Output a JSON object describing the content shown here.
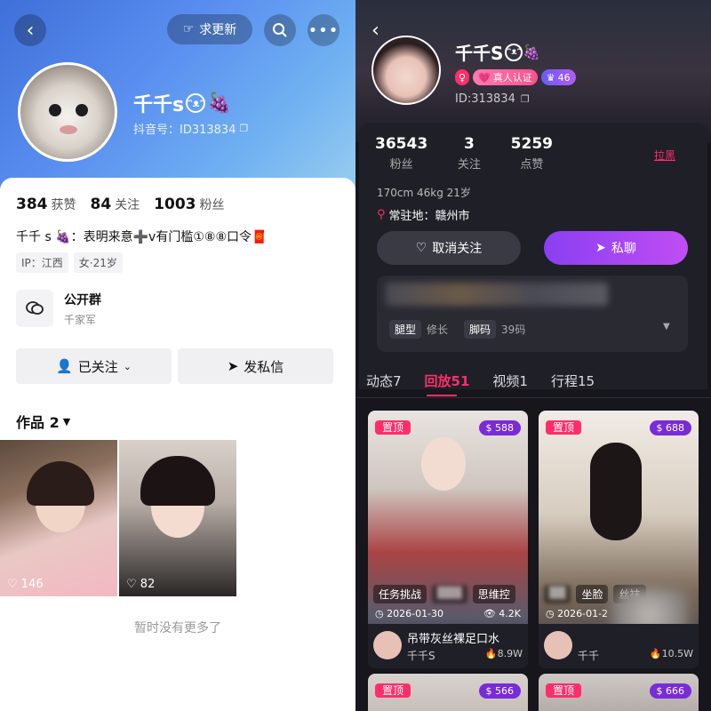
{
  "left": {
    "top_bar": {
      "update_label": "求更新"
    },
    "profile": {
      "name": "千千s",
      "name_emoji": "🍇",
      "douyin_id": "抖音号：ID313834"
    },
    "stats": [
      {
        "num": "384",
        "label": "获赞"
      },
      {
        "num": "84",
        "label": "关注"
      },
      {
        "num": "1003",
        "label": "粉丝"
      }
    ],
    "bio": "千千 s  🍇：表明来意➕v有门槛①⑧⑧口令🧧",
    "tags": [
      "IP：江西",
      "女·21岁"
    ],
    "group": {
      "title": "公开群",
      "subtitle": "千家军"
    },
    "buttons": {
      "followed": "已关注",
      "message": "发私信"
    },
    "works_label": "作品 2",
    "thumbs": [
      {
        "likes": "146"
      },
      {
        "likes": "82"
      }
    ],
    "no_more": "暂时没有更多了"
  },
  "right": {
    "profile": {
      "name": "千千S",
      "id_text": "ID:313834",
      "badge_verified": "真人认证",
      "badge_level": "46"
    },
    "stats": [
      {
        "num": "36543",
        "label": "粉丝"
      },
      {
        "num": "3",
        "label": "关注"
      },
      {
        "num": "5259",
        "label": "点赞"
      }
    ],
    "block_label": "拉黑",
    "body_info": "170cm  46kg  21岁",
    "location": "常驻地：赣州市",
    "buttons": {
      "unfollow": "取消关注",
      "chat": "私聊"
    },
    "attrs": [
      {
        "key": "腿型",
        "val": "修长"
      },
      {
        "key": "脚码",
        "val": "39码"
      }
    ],
    "tabs": [
      "动态7",
      "回放51",
      "视频1",
      "行程15"
    ],
    "cards": [
      {
        "pin": "置顶",
        "coins": "588",
        "chips": [
          "任务挑战",
          "思维控"
        ],
        "date": "2026-01-30",
        "views": "4.2K",
        "title": "吊带灰丝裸足口水",
        "author": "千千S",
        "heat": "8.9W"
      },
      {
        "pin": "置顶",
        "coins": "688",
        "chips": [
          "坐脸",
          "丝袜"
        ],
        "date": "2026-01-2",
        "views": "",
        "title": "",
        "author": "千千",
        "heat": "10.5W"
      }
    ],
    "cards_bottom": [
      {
        "pin": "置顶",
        "coins": "566"
      },
      {
        "pin": "置顶",
        "coins": "666"
      }
    ],
    "colors": {
      "accent": "#ff2e6a",
      "purple": "#7a2bd8"
    }
  }
}
